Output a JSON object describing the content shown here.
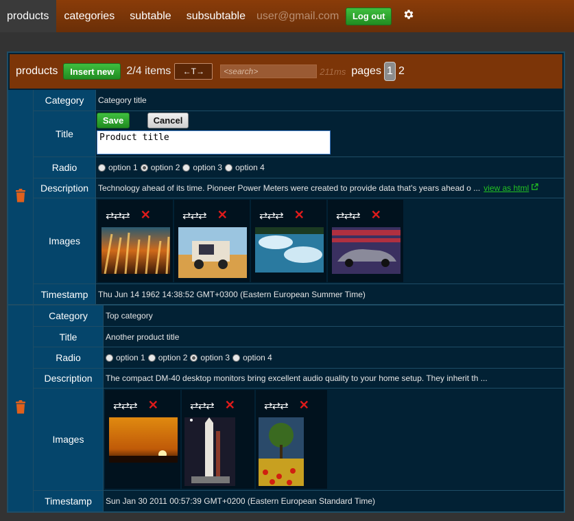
{
  "nav": {
    "tabs": [
      "products",
      "categories",
      "subtable",
      "subsubtable"
    ],
    "active_tab": "products",
    "user_email": "user@gmail.com",
    "logout_label": "Log out",
    "settings_icon": "gear-icon"
  },
  "toolbar": {
    "title": "products",
    "insert_label": "Insert new",
    "items_count": "2/4 items",
    "sort_label": "←T→",
    "search_placeholder": "<search>",
    "timing": "211ms",
    "pages_label": "pages",
    "pages": [
      "1",
      "2"
    ],
    "current_page": "1"
  },
  "labels": {
    "category": "Category",
    "title": "Title",
    "radio": "Radio",
    "description": "Description",
    "images": "Images",
    "timestamp": "Timestamp"
  },
  "records": [
    {
      "category": "Category title",
      "title_value": "Product title",
      "editing": true,
      "save_label": "Save",
      "cancel_label": "Cancel",
      "radio_options": [
        "option 1",
        "option 2",
        "option 3",
        "option 4"
      ],
      "radio_selected": 2,
      "description": "Technology ahead of its time. Pioneer Power Meters were created to provide data that's years ahead o ...",
      "view_html_label": "view as html",
      "images": [
        {
          "swap": "⇄⇄⇄",
          "remove": "✕",
          "subject": "orange light streaks"
        },
        {
          "swap": "⇄⇄⇄",
          "remove": "✕",
          "subject": "truck in desert"
        },
        {
          "swap": "⇄⇄⇄",
          "remove": "✕",
          "subject": "sky reflection"
        },
        {
          "swap": "⇄⇄⇄",
          "remove": "✕",
          "subject": "classic car with flag"
        }
      ],
      "timestamp": "Thu Jun 14 1962 14:38:52 GMT+0300 (Eastern European Summer Time)"
    },
    {
      "category": "Top category",
      "title_value": "Another product title",
      "editing": false,
      "radio_options": [
        "option 1",
        "option 2",
        "option 3",
        "option 4"
      ],
      "radio_selected": 3,
      "description": "The compact DM-40 desktop monitors bring excellent audio quality to your home setup. They inherit th ...",
      "images": [
        {
          "swap": "⇄⇄⇄",
          "remove": "✕",
          "subject": "sunset"
        },
        {
          "swap": "⇄⇄⇄",
          "remove": "✕",
          "subject": "rocket on launch pad"
        },
        {
          "swap": "⇄⇄⇄",
          "remove": "✕",
          "subject": "tree in tulip field"
        }
      ],
      "timestamp": "Sun Jan 30 2011 00:57:39 GMT+0200 (Eastern European Standard Time)"
    }
  ],
  "colors": {
    "nav_bg": "#7a3508",
    "toolbar_bg": "#7c3508",
    "panel_bg": "#022134",
    "label_bg": "#05456b",
    "accent_green": "#2aa52a",
    "trash": "#e0601c"
  }
}
